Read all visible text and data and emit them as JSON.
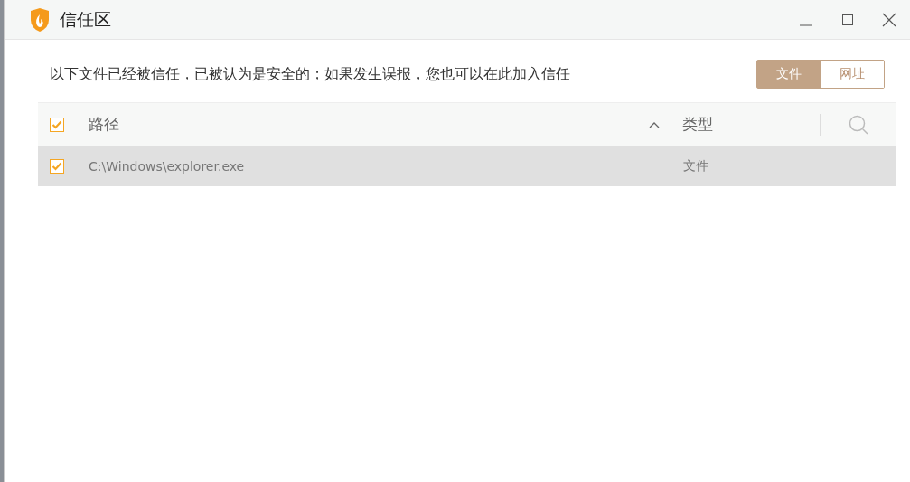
{
  "window": {
    "title": "信任区"
  },
  "description": "以下文件已经被信任，已被认为是安全的；如果发生误报，您也可以在此加入信任",
  "tabs": [
    {
      "label": "文件",
      "selected": true
    },
    {
      "label": "网址",
      "selected": false
    }
  ],
  "table": {
    "select_all_checked": true,
    "columns": [
      {
        "label": "路径",
        "sorted": true
      },
      {
        "label": "类型",
        "sorted": false
      }
    ],
    "rows": [
      {
        "checked": true,
        "selected": true,
        "path": "C:\\Windows\\explorer.exe",
        "type": "文件"
      }
    ]
  }
}
